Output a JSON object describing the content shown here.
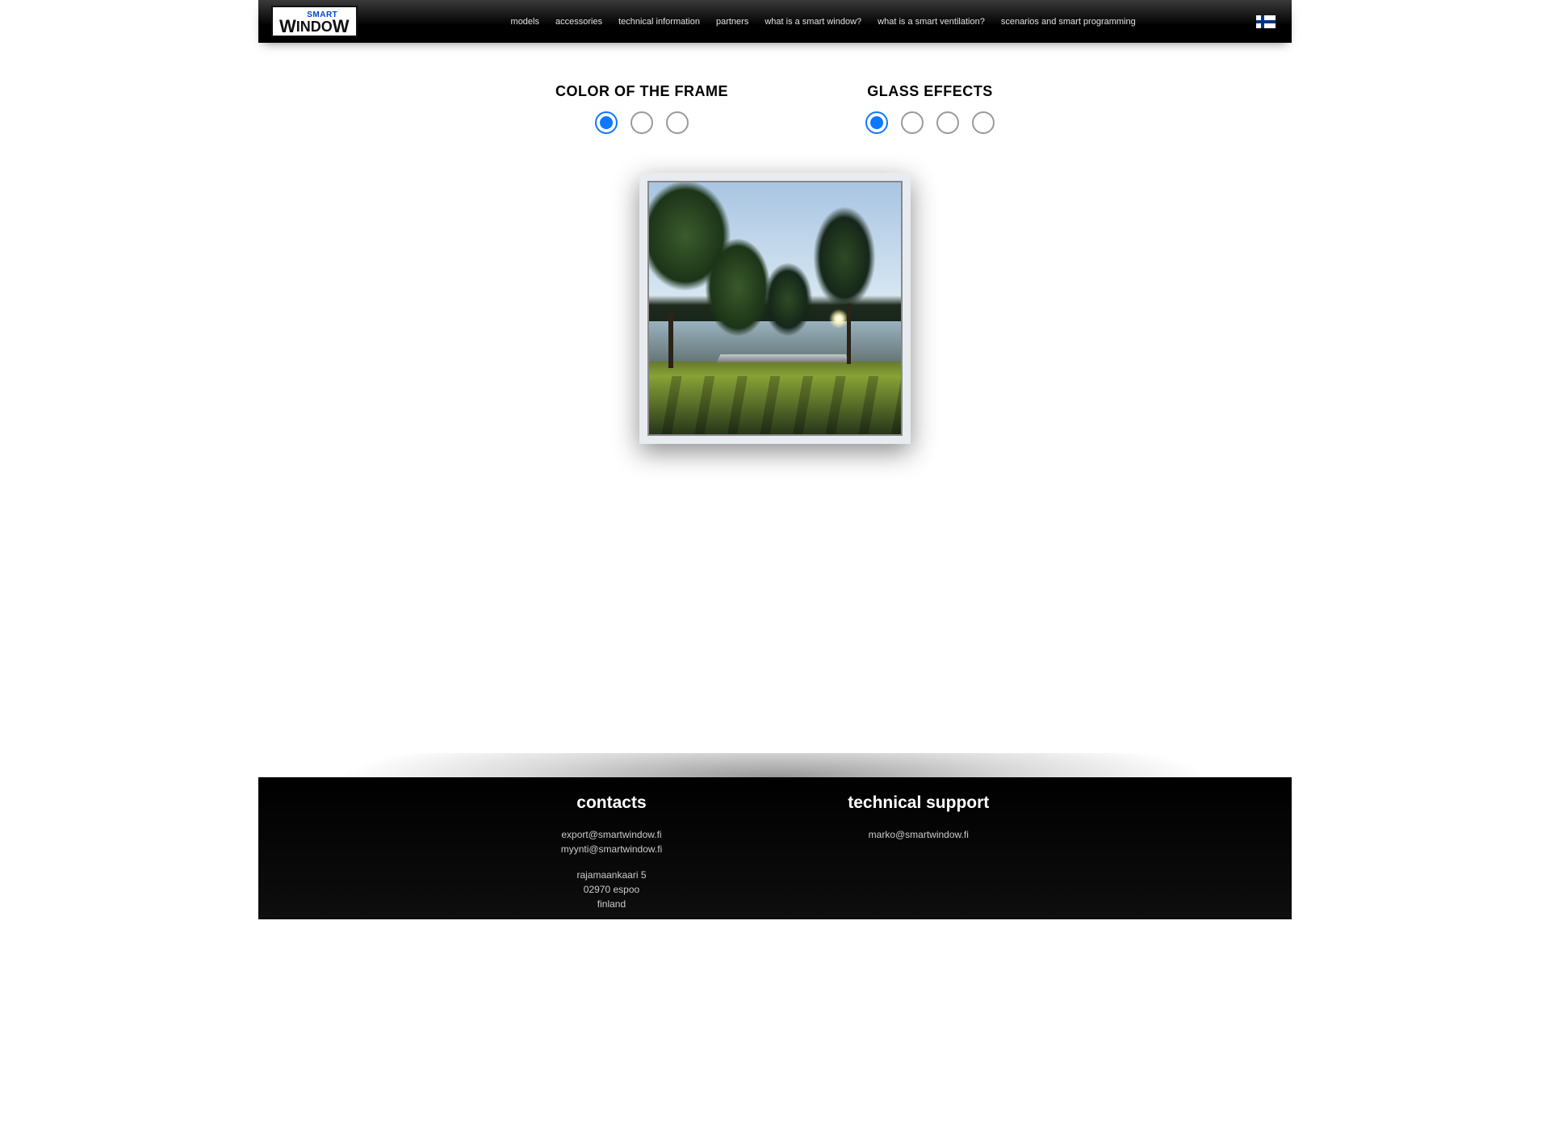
{
  "brand": {
    "top": "SMART",
    "bottom_mid": "INDO"
  },
  "nav": {
    "models": "models",
    "accessories": "accessories",
    "technical": "technical information",
    "partners": "partners",
    "smartwindow": "what is a smart window?",
    "smartvent": "what is a smart ventilation?",
    "scenarios": "scenarios and smart programming"
  },
  "frame": {
    "heading": "COLOR OF THE FRAME",
    "options": 3,
    "selected": 0
  },
  "glass": {
    "heading": "GLASS EFFECTS",
    "options": 4,
    "selected": 0
  },
  "footer": {
    "contacts": {
      "heading": "contacts",
      "email1": "export@smartwindow.fi",
      "email2": "myynti@smartwindow.fi",
      "addr1": "rajamaankaari 5",
      "addr2": "02970 espoo",
      "addr3": "finland"
    },
    "support": {
      "heading": "technical support",
      "email": "marko@smartwindow.fi"
    }
  }
}
